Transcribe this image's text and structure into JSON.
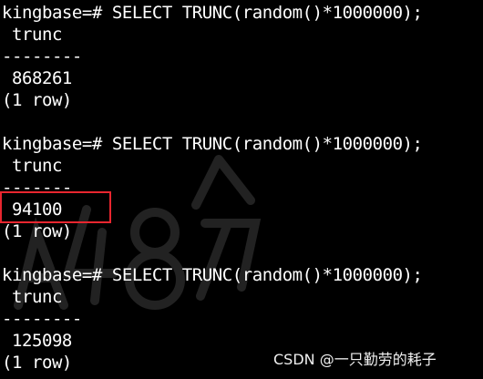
{
  "terminal": {
    "blocks": [
      {
        "prompt_line": "kingbase=# SELECT TRUNC(random()*1000000);",
        "header": " trunc",
        "separator": "--------",
        "value": " 868261",
        "footer": "(1 row)"
      },
      {
        "prompt_line": "kingbase=# SELECT TRUNC(random()*1000000);",
        "header": " trunc",
        "separator": "-------",
        "value": " 94100",
        "footer": "(1 row)"
      },
      {
        "prompt_line": "kingbase=# SELECT TRUNC(random()*1000000);",
        "header": " trunc",
        "separator": "--------",
        "value": " 125098",
        "footer": "(1 row)"
      }
    ]
  },
  "watermark": {
    "credit": "CSDN @一只勤劳的耗子"
  },
  "colors": {
    "background": "#000000",
    "text": "#ffffff",
    "highlight": "#e8262f"
  }
}
